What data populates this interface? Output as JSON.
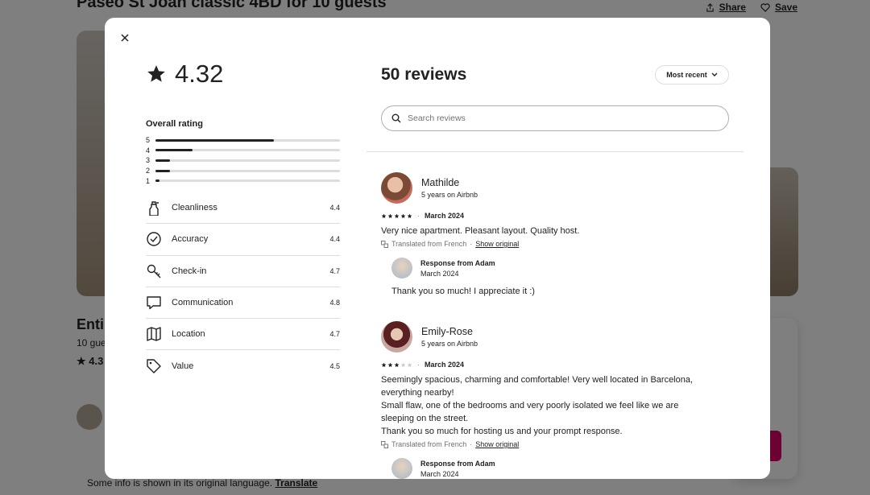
{
  "background": {
    "listing_title": "Paseo St Joan classic 4BD for 10 guests",
    "share_label": "Share",
    "save_label": "Save",
    "entire_text": "Entir",
    "guests_text": "10 gue",
    "rating_text": "4.3",
    "footnote_text": "Some info is shown in its original language.",
    "footnote_link": "Translate"
  },
  "modal": {
    "overall_rating": "4.32",
    "overall_label": "Overall rating",
    "distribution": [
      {
        "label": "5",
        "fraction": 0.64
      },
      {
        "label": "4",
        "fraction": 0.2
      },
      {
        "label": "3",
        "fraction": 0.08
      },
      {
        "label": "2",
        "fraction": 0.08
      },
      {
        "label": "1",
        "fraction": 0.02
      }
    ],
    "categories": [
      {
        "name": "Cleanliness",
        "value": "4.4",
        "icon": "spray-bottle-icon"
      },
      {
        "name": "Accuracy",
        "value": "4.4",
        "icon": "check-circle-icon"
      },
      {
        "name": "Check-in",
        "value": "4.7",
        "icon": "key-icon"
      },
      {
        "name": "Communication",
        "value": "4.8",
        "icon": "message-icon"
      },
      {
        "name": "Location",
        "value": "4.7",
        "icon": "map-icon"
      },
      {
        "name": "Value",
        "value": "4.5",
        "icon": "tag-icon"
      }
    ],
    "reviews_title": "50 reviews",
    "sort_label": "Most recent",
    "search_placeholder": "Search reviews",
    "reviews": [
      {
        "name": "Mathilde",
        "tenure": "5 years on Airbnb",
        "stars": 5,
        "date": "March 2024",
        "text": "Very nice apartment. Pleasant layout. Quality host.",
        "translated_label": "Translated from French",
        "show_original": "Show original",
        "response": {
          "title": "Response from Adam",
          "date": "March 2024",
          "text": "Thank you so much! I appreciate it :)"
        }
      },
      {
        "name": "Emily-Rose",
        "tenure": "5 years on Airbnb",
        "stars": 3,
        "date": "March 2024",
        "text_lines": [
          "Seemingly spacious, charming and comfortable! Very well located in Barcelona,",
          "everything nearby!",
          "Small flaw, one of the bedrooms and very poorly isolated we feel like we are",
          "sleeping on the street.",
          "Thank you so much for hosting us and your prompt response."
        ],
        "translated_label": "Translated from French",
        "show_original": "Show original",
        "response": {
          "title": "Response from Adam",
          "date": "March 2024"
        }
      }
    ]
  },
  "colors": {
    "text": "#222222",
    "muted": "#717171",
    "divider": "#dddddd",
    "brand": "#d70466"
  }
}
